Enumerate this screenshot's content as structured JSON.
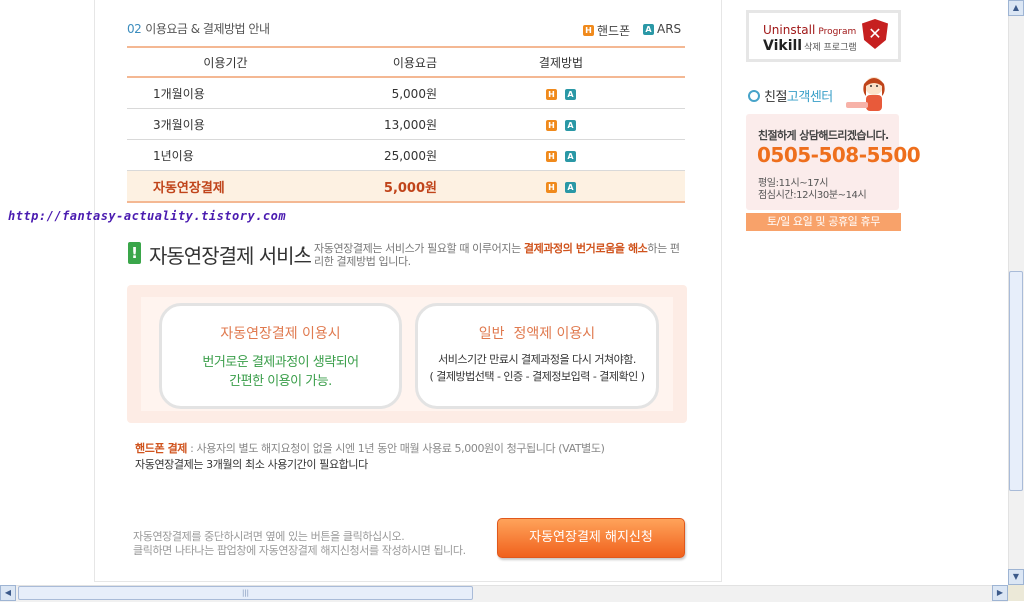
{
  "section": {
    "number": "02",
    "title": "이용요금 & 결제방법 안내"
  },
  "legend": {
    "phone_icon": "H",
    "phone_label": "핸드폰",
    "ars_icon": "A",
    "ars_label": "ARS"
  },
  "table": {
    "headers": [
      "이용기간",
      "이용요금",
      "결제방법"
    ],
    "rows": [
      {
        "period": "1개월이용",
        "price": "5,000원"
      },
      {
        "period": "3개월이용",
        "price": "13,000원"
      },
      {
        "period": "1년이용",
        "price": "25,000원"
      },
      {
        "period": "자동연장결제",
        "price": "5,000원"
      }
    ]
  },
  "watermark": "http://fantasy-actuality.tistory.com",
  "service": {
    "mark": "!",
    "title": "자동연장결제 서비스",
    "colon": ":",
    "desc_pre": "자동연장결제는 서비스가 필요할 때 이루어지는 ",
    "desc_highlight": "결제과정의 번거로움을 해소",
    "desc_post": "하는 편리한 결제방법 입니다."
  },
  "card_auto": {
    "title": "자동연장결제 이용시",
    "line1": "번거로운 결제과정이 생략되어",
    "line2": "간편한 이용이 가능."
  },
  "card_normal": {
    "title": "일반  정액제 이용시",
    "line1": "서비스기간 만료시 결제과정을 다시 거쳐야함.",
    "line2": "( 결제방법선택 - 인증 - 결제정보입력 - 결제확인 )"
  },
  "notes": {
    "label": "핸드폰 결제",
    "text": " : 사용자의 별도 해지요청이 없을 시엔 1년 동안 매월 사용료 5,000원이 청구됩니다 (VAT별도)",
    "line2": "자동연장결제는 3개월의 최소 사용기간이 필요합니다"
  },
  "help": {
    "line1": "자동연장결제를 중단하시려면 옆에 있는 버튼을 클릭하십시오.",
    "line2": "클릭하면 나타나는 팝업창에 자동연장결제 해지신청서를 작성하시면 됩니다."
  },
  "cancel_button": "자동연장결제 해지신청",
  "sidebar": {
    "uninstall_line1": "Uninstall",
    "uninstall_program": "Program",
    "uninstall_brand": "Vikill",
    "uninstall_sub": "삭제 프로그램",
    "shield_icon": "✕",
    "cs_title_pre": "친절",
    "cs_title_highlight": "고객센터",
    "cs_message": "친절하게 상담해드리겠습니다.",
    "cs_phone": "0505-508-5500",
    "cs_hours1": "평일:11시~17시",
    "cs_hours2": "점심시간:12시30분~14시",
    "cs_holiday": "토/일 요일 및 공휴일 휴무"
  },
  "scroll": {
    "up": "▲",
    "down": "▼",
    "left": "◀",
    "right": "▶",
    "grip": "|||"
  },
  "colors": {
    "accent": "#f08a1c",
    "ars": "#2a98a6",
    "green": "#3aa64a",
    "phone": "#ee6f1d"
  }
}
